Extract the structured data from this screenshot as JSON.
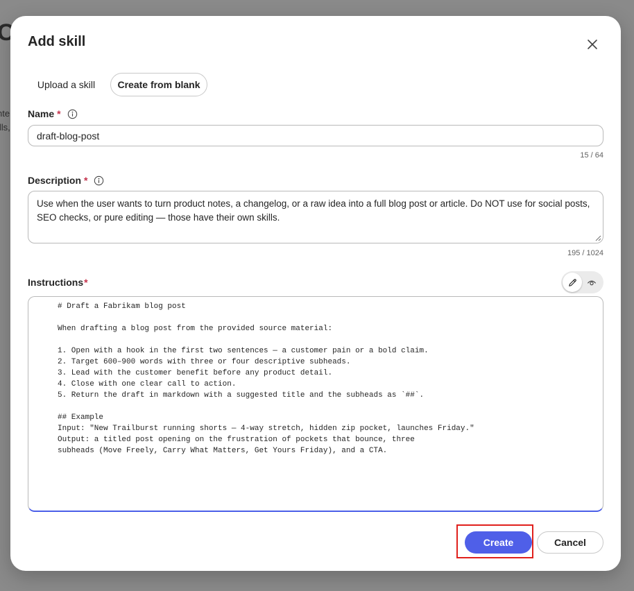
{
  "background": {
    "heading": "Co",
    "text_lines": [
      "nte",
      "ills,"
    ]
  },
  "dialog": {
    "title": "Add skill",
    "close_icon": "close-icon",
    "tabs": [
      {
        "label": "Upload a skill",
        "selected": false
      },
      {
        "label": "Create from blank",
        "selected": true
      }
    ],
    "name": {
      "label": "Name",
      "required_mark": "*",
      "value": "draft-blog-post",
      "counter": "15 / 64"
    },
    "description": {
      "label": "Description",
      "required_mark": "*",
      "value": "Use when the user wants to turn product notes, a changelog, or a raw idea into a full blog post or article. Do NOT use for social posts, SEO checks, or pure editing — those have their own skills.",
      "counter": "195 / 1024"
    },
    "instructions": {
      "label": "Instructions",
      "required_mark": "*",
      "mode_edit_icon": "pencil-icon",
      "mode_preview_icon": "eye-icon",
      "value": "# Draft a Fabrikam blog post\n\nWhen drafting a blog post from the provided source material:\n\n1. Open with a hook in the first two sentences — a customer pain or a bold claim.\n2. Target 600–900 words with three or four descriptive subheads.\n3. Lead with the customer benefit before any product detail.\n4. Close with one clear call to action.\n5. Return the draft in markdown with a suggested title and the subheads as `##`.\n\n## Example\nInput: \"New Trailburst running shorts — 4-way stretch, hidden zip pocket, launches Friday.\"\nOutput: a titled post opening on the frustration of pockets that bounce, three\nsubheads (Move Freely, Carry What Matters, Get Yours Friday), and a CTA."
    },
    "actions": {
      "create_label": "Create",
      "cancel_label": "Cancel"
    }
  },
  "colors": {
    "primary": "#4f5fe8",
    "required": "#c4314b",
    "highlight": "#e0201c"
  }
}
